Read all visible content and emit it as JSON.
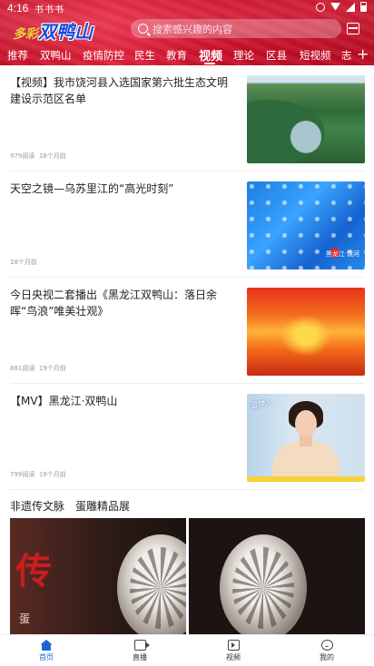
{
  "status_bar": {
    "time": "4:16",
    "app_icons": "书书书"
  },
  "header": {
    "logo_prefix": "多彩",
    "logo_main": "双鸭山",
    "search_placeholder": "搜索感兴趣的内容",
    "tabs": [
      "推荐",
      "双鸭山",
      "疫情防控",
      "民生",
      "教育",
      "视频",
      "理论",
      "区县",
      "短视频",
      "志"
    ],
    "active_tab": "视频"
  },
  "feed": [
    {
      "title": "【视频】我市饶河县入选国家第六批生态文明建设示范区名单",
      "views": "979阅读",
      "time": "18个月前",
      "thumb": "forest"
    },
    {
      "title": "天空之镜—乌苏里江的“高光时刻”",
      "views": "",
      "time": "18个月前",
      "thumb": "water",
      "thumb_badge": "黑龙江·饶河"
    },
    {
      "title": "今日央视二套播出《黑龙江双鸭山：落日余晖“鸟浪”唯美壮观》",
      "views": "881阅读",
      "time": "19个月前",
      "thumb": "sunset"
    },
    {
      "title": "【MV】黑龙江·双鸭山",
      "views": "799阅读",
      "time": "19个月前",
      "thumb": "person",
      "thumb_caption": "追梦人"
    }
  ],
  "big_item": {
    "title": "非遗传文脉　蛋雕精品展",
    "overlay_big": "传",
    "overlay_small": "蛋"
  },
  "bottom_nav": {
    "items": [
      {
        "label": "首页",
        "icon": "home-icon",
        "active": true
      },
      {
        "label": "直播",
        "icon": "live-icon",
        "active": false
      },
      {
        "label": "视频",
        "icon": "video-icon",
        "active": false
      },
      {
        "label": "我的",
        "icon": "me-icon",
        "active": false
      }
    ]
  },
  "colors": {
    "header_red": "#d01a30",
    "accent_blue": "#1a63d8"
  }
}
